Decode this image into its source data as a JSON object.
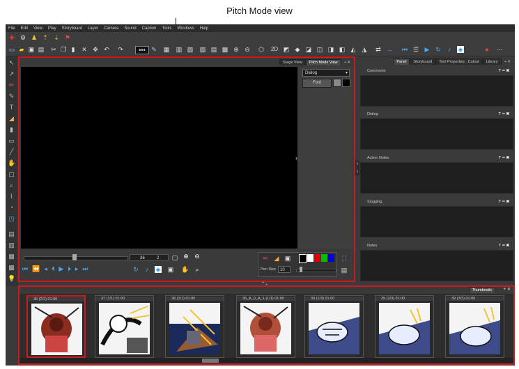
{
  "annotation": {
    "label": "Pitch Mode view"
  },
  "menu": [
    "File",
    "Edit",
    "View",
    "Play",
    "Storyboard",
    "Layer",
    "Camera",
    "Sound",
    "Caption",
    "Tools",
    "Windows",
    "Help"
  ],
  "toolbar": {
    "twod_label": "2D"
  },
  "view": {
    "tabs": [
      "Stage View",
      "Pitch Mode View"
    ],
    "active_tab": "Pitch Mode View",
    "dialog_select": "Dialog",
    "font_button": "Font",
    "frame_value": "36",
    "frame_step": "2",
    "pen_size_label": "Pen Size",
    "pen_size_value": "10",
    "swatches": [
      "#000000",
      "#ffffff",
      "#e00000",
      "#00c000",
      "#0000e0"
    ]
  },
  "right_panel": {
    "tabs": [
      "Panel",
      "Storyboard",
      "Tool Properties : Colour",
      "Library"
    ],
    "active_tab": "Panel",
    "sections": [
      "Comments",
      "Dialog",
      "Action Notes",
      "Slugging",
      "Notes"
    ]
  },
  "thumbnails": {
    "title": "Thumbnails",
    "items": [
      {
        "label": "36 (2/2) 01:00",
        "selected": true
      },
      {
        "label": "37 (1/1) 01:00",
        "selected": false
      },
      {
        "label": "38 (1/1) 01:00",
        "selected": false
      },
      {
        "label": "36_A_0_A_1 (1/1) 01:00",
        "selected": false
      },
      {
        "label": "39 (1/3) 01:00",
        "selected": false
      },
      {
        "label": "39 (2/3) 01:00",
        "selected": false
      },
      {
        "label": "39 (3/3) 01:00",
        "selected": false
      }
    ]
  },
  "colors": {
    "highlight": "#d0191f",
    "background": "#3a3a3a",
    "accent": "#1e88e5"
  }
}
